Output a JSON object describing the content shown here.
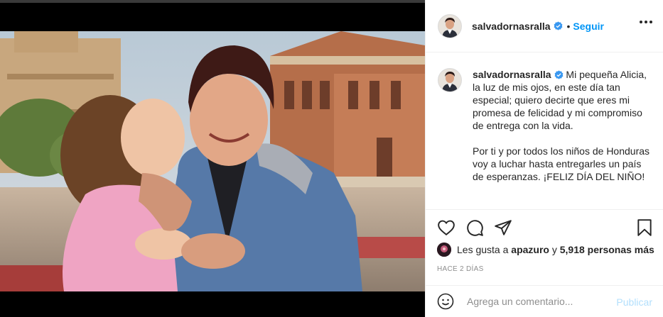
{
  "post": {
    "username": "salvadornasralla",
    "follow_label": "Seguir",
    "separator": "•",
    "caption_user": "salvadornasralla",
    "caption_p1": "Mi pequeña Alicia, la luz de mis ojos, en este día tan especial; quiero decirte que eres mi promesa de felicidad y mi compromiso de entrega con la vida.",
    "caption_p2": "Por ti y por todos los niños de Honduras voy a luchar hasta entregarles un país de esperanzas. ¡FELIZ DÍA DEL NIÑO!",
    "likes_prefix": "Les gusta a",
    "likes_user": "apazuro",
    "likes_and": "y",
    "likes_count": "5,918 personas más",
    "time_ago": "HACE 2 DÍAS"
  },
  "comment": {
    "placeholder": "Agrega un comentario...",
    "publish_label": "Publicar"
  },
  "icons": {
    "more": "more-options-icon",
    "verified": "verified-badge-icon",
    "like": "heart-icon",
    "comment": "comment-icon",
    "share": "share-icon",
    "save": "bookmark-icon",
    "emoji": "emoji-icon"
  },
  "colors": {
    "accent": "#0095f6",
    "publish_disabled": "#b2dffc",
    "muted": "#8e8e8e",
    "border": "#efefef"
  }
}
